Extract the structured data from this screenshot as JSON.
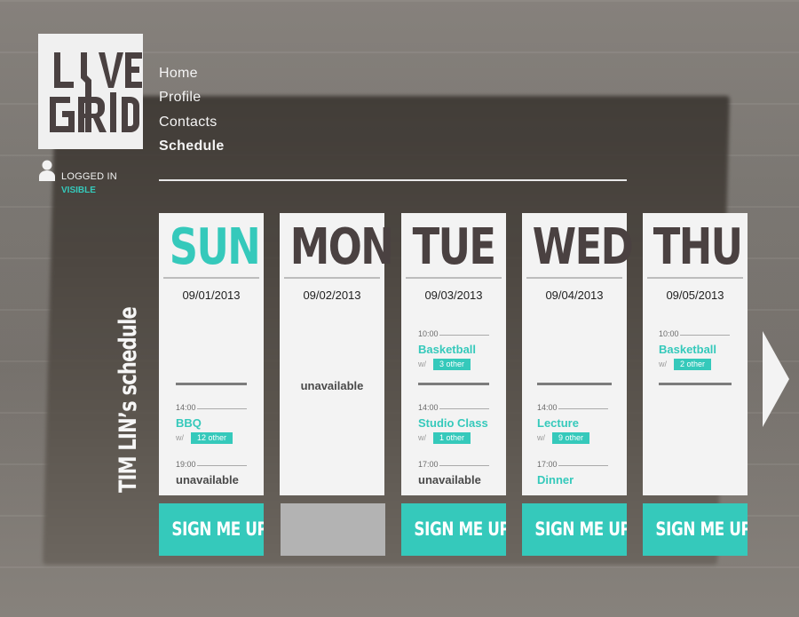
{
  "logo": {
    "line1": "LIVE",
    "line2": "GRID",
    "name": "live-grid-logo"
  },
  "user": {
    "logged_label": "LOGGED IN",
    "visibility": "VISIBLE",
    "icon": "user-icon"
  },
  "nav": {
    "items": [
      {
        "label": "Home",
        "active": false
      },
      {
        "label": "Profile",
        "active": false
      },
      {
        "label": "Contacts",
        "active": false
      },
      {
        "label": "Schedule",
        "active": true
      }
    ]
  },
  "schedule_title": "TIM LIN’s schedule",
  "colors": {
    "accent": "#35c9bb",
    "card": "#f3f3f3",
    "dark_text": "#4a4141",
    "disabled": "#b3b3b3"
  },
  "days": [
    {
      "name": "SUN",
      "date": "09/01/2013",
      "signup": "SIGN ME UP!",
      "events": [
        {
          "time": "14:00",
          "title": "BBQ",
          "with": "w/",
          "others": "12 other"
        },
        {
          "time": "19:00",
          "title": "unavailable"
        }
      ]
    },
    {
      "name": "MON",
      "date": "09/02/2013",
      "status": "unavailable"
    },
    {
      "name": "TUE",
      "date": "09/03/2013",
      "signup": "SIGN ME UP!",
      "events": [
        {
          "time": "10:00",
          "title": "Basketball",
          "with": "w/",
          "others": "3 other"
        },
        {
          "time": "14:00",
          "title": "Studio Class",
          "with": "w/",
          "others": "1 other"
        },
        {
          "time": "17:00",
          "title": "unavailable"
        }
      ]
    },
    {
      "name": "WED",
      "date": "09/04/2013",
      "signup": "SIGN ME UP!",
      "events": [
        {
          "time": "14:00",
          "title": "Lecture",
          "with": "w/",
          "others": "9 other"
        },
        {
          "time": "17:00",
          "title": "Dinner"
        }
      ]
    },
    {
      "name": "THU",
      "date": "09/05/2013",
      "signup": "SIGN ME UP!",
      "events": [
        {
          "time": "10:00",
          "title": "Basketball",
          "with": "w/",
          "others": "2 other"
        }
      ]
    }
  ],
  "next_icon": "chevron-right-icon"
}
